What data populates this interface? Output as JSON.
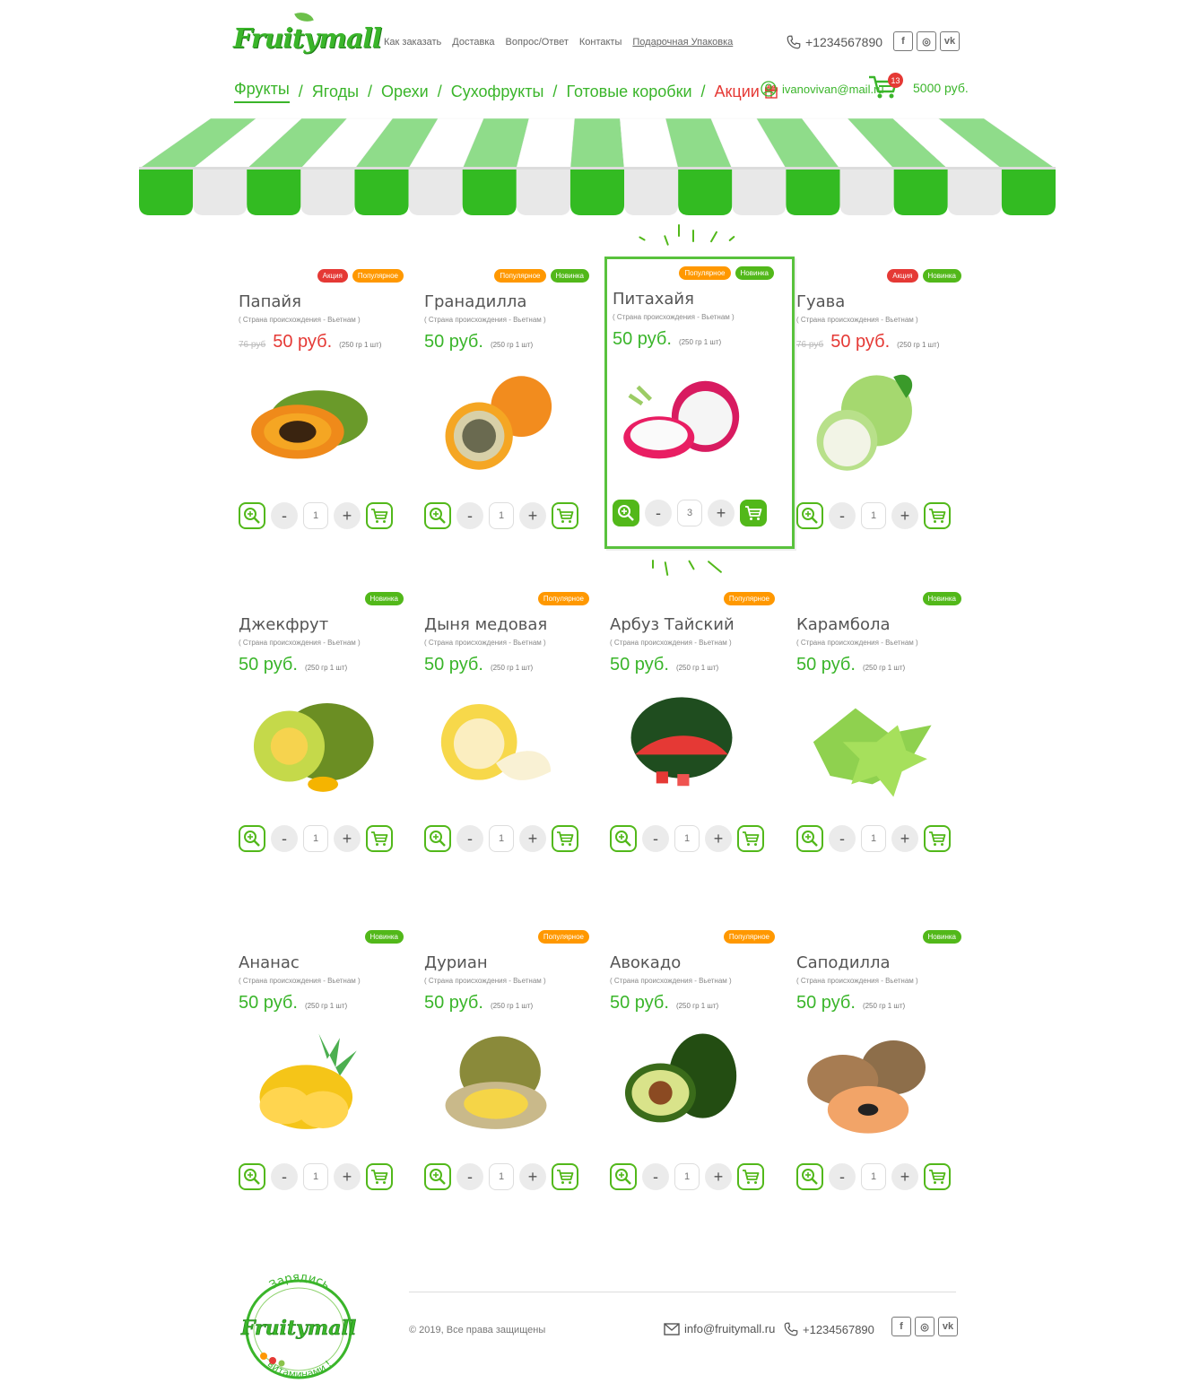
{
  "brand": {
    "logo_text": "Fruitymall"
  },
  "topnav": [
    "Как заказать",
    "Доставка",
    "Вопрос/Ответ",
    "Контакты",
    "Подарочная Упаковка"
  ],
  "phone": "+1234567890",
  "categories": [
    "Фрукты",
    "Ягоды",
    "Орехи",
    "Сухофрукты",
    "Готовые коробки",
    "Акции"
  ],
  "account": {
    "email": "ivanovivan@mail.ru",
    "cart_count": "13",
    "total": "5000 руб."
  },
  "badges": {
    "sale": "Акция",
    "popular": "Популярное",
    "new": "Новинка"
  },
  "origin_text": "( Страна происхождения  - Вьетнам )",
  "unit_text": "(250 гр 1 шт)",
  "products": [
    {
      "name": "Папайя",
      "price": "50 руб.",
      "old_price": "76 руб",
      "qty": "1",
      "badges": [
        "sale",
        "popular"
      ],
      "sale": true
    },
    {
      "name": "Гранадилла",
      "price": "50 руб.",
      "qty": "1",
      "badges": [
        "popular",
        "new"
      ]
    },
    {
      "name": "Питахайя",
      "price": "50 руб.",
      "qty": "3",
      "badges": [
        "popular",
        "new"
      ],
      "highlight": true
    },
    {
      "name": "Гуава",
      "price": "50 руб.",
      "old_price": "76 руб",
      "qty": "1",
      "badges": [
        "sale",
        "new"
      ],
      "sale": true
    },
    {
      "name": "Джекфрут",
      "price": "50 руб.",
      "qty": "1",
      "badges": [
        "new"
      ]
    },
    {
      "name": "Дыня медовая",
      "price": "50 руб.",
      "qty": "1",
      "badges": [
        "popular"
      ]
    },
    {
      "name": "Арбуз Тайский",
      "price": "50 руб.",
      "qty": "1",
      "badges": [
        "popular"
      ]
    },
    {
      "name": "Карамбола",
      "price": "50 руб.",
      "qty": "1",
      "badges": [
        "new"
      ]
    },
    {
      "name": "Ананас",
      "price": "50 руб.",
      "qty": "1",
      "badges": [
        "new"
      ]
    },
    {
      "name": "Дуриан",
      "price": "50 руб.",
      "qty": "1",
      "badges": [
        "popular"
      ]
    },
    {
      "name": "Авокадо",
      "price": "50 руб.",
      "qty": "1",
      "badges": [
        "popular"
      ]
    },
    {
      "name": "Саподилла",
      "price": "50 руб.",
      "qty": "1",
      "badges": [
        "new"
      ]
    }
  ],
  "footer": {
    "logo_top": "Зарядись",
    "logo_bottom": "витаминами !",
    "copyright": "© 2019, Все права защищены",
    "email": "info@fruitymall.ru",
    "phone": "+1234567890"
  },
  "colors": {
    "green": "#3ab52a",
    "red": "#e53935",
    "orange": "#ff9800",
    "badge_green": "#52b81a"
  }
}
